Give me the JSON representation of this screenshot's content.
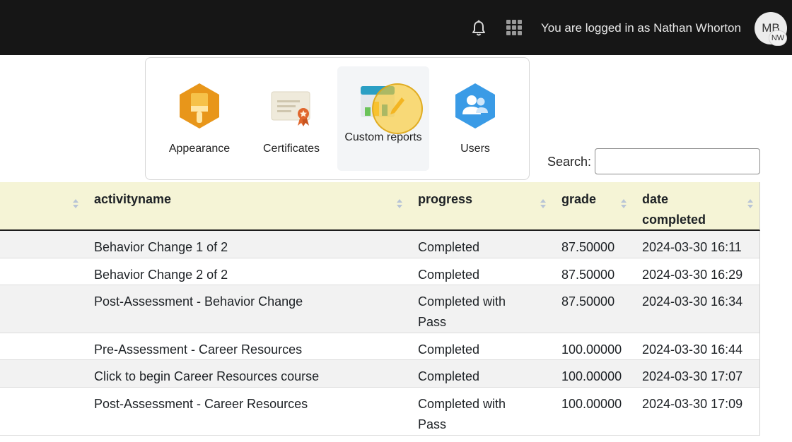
{
  "navbar": {
    "login_text": "You are logged in as Nathan Whorton",
    "avatar_initials": "MB",
    "avatar_badge": "NW",
    "icons": [
      "bell-icon",
      "app-grid-icon"
    ]
  },
  "menu": {
    "items": [
      {
        "label": "Appearance",
        "icon": "paintbrush-hexagon-icon"
      },
      {
        "label": "Certificates",
        "icon": "certificate-ribbon-icon"
      },
      {
        "label": "Custom reports",
        "icon": "report-chart-pencil-icon"
      },
      {
        "label": "Users",
        "icon": "users-hexagon-icon"
      }
    ]
  },
  "search": {
    "label": "Search:",
    "value": ""
  },
  "table": {
    "headers": {
      "activityname": "activityname",
      "progress": "progress",
      "grade": "grade",
      "date": "date completed"
    },
    "rows": [
      {
        "activityname": "Behavior Change 1 of 2",
        "progress": "Completed",
        "grade": "87.50000",
        "date": "2024-03-30 16:11"
      },
      {
        "activityname": "Behavior Change 2 of 2",
        "progress": "Completed",
        "grade": "87.50000",
        "date": "2024-03-30 16:29"
      },
      {
        "activityname": "Post-Assessment - Behavior Change",
        "progress": "Completed with Pass",
        "grade": "87.50000",
        "date": "2024-03-30 16:34"
      },
      {
        "activityname": "Pre-Assessment - Career Resources",
        "progress": "Completed",
        "grade": "100.00000",
        "date": "2024-03-30 16:44"
      },
      {
        "activityname": "Click to begin Career Resources course",
        "progress": "Completed",
        "grade": "100.00000",
        "date": "2024-03-30 17:07"
      },
      {
        "activityname": "Post-Assessment - Career Resources",
        "progress": "Completed with Pass",
        "grade": "100.00000",
        "date": "2024-03-30 17:09"
      }
    ]
  },
  "colors": {
    "navbar_bg": "#161616",
    "table_header_bg": "#f5f4d6",
    "appearance_orange": "#e8961a",
    "users_blue": "#3a9be6",
    "cursor_highlight": "#f8c828"
  }
}
